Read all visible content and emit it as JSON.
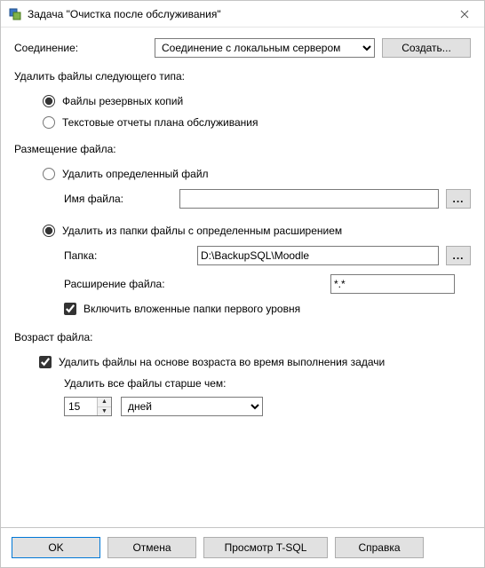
{
  "window": {
    "title": "Задача \"Очистка после обслуживания\""
  },
  "connection": {
    "label": "Соединение:",
    "value": "Соединение с локальным сервером",
    "create_btn": "Создать..."
  },
  "file_type": {
    "section": "Удалить файлы следующего типа:",
    "opt_backup": "Файлы резервных копий",
    "opt_reports": "Текстовые отчеты плана обслуживания"
  },
  "location": {
    "section": "Размещение файла:",
    "opt_single": "Удалить определенный файл",
    "filename_label": "Имя файла:",
    "filename_value": "",
    "browse1_label": "...",
    "opt_folder": "Удалить из папки файлы с определенным расширением",
    "folder_label": "Папка:",
    "folder_value": "D:\\BackupSQL\\Moodle",
    "browse2_label": "...",
    "ext_label": "Расширение файла:",
    "ext_value": "*.*",
    "include_sub": "Включить вложенные папки первого уровня"
  },
  "age": {
    "section": "Возраст файла:",
    "delete_by_age": "Удалить файлы на основе возраста во время выполнения задачи",
    "older_prefix": "Удалить все файлы",
    "older_suffix": "старше чем:",
    "value": "15",
    "unit": "дней"
  },
  "footer": {
    "ok": "OK",
    "cancel": "Отмена",
    "tsql": "Просмотр T-SQL",
    "help": "Справка"
  }
}
